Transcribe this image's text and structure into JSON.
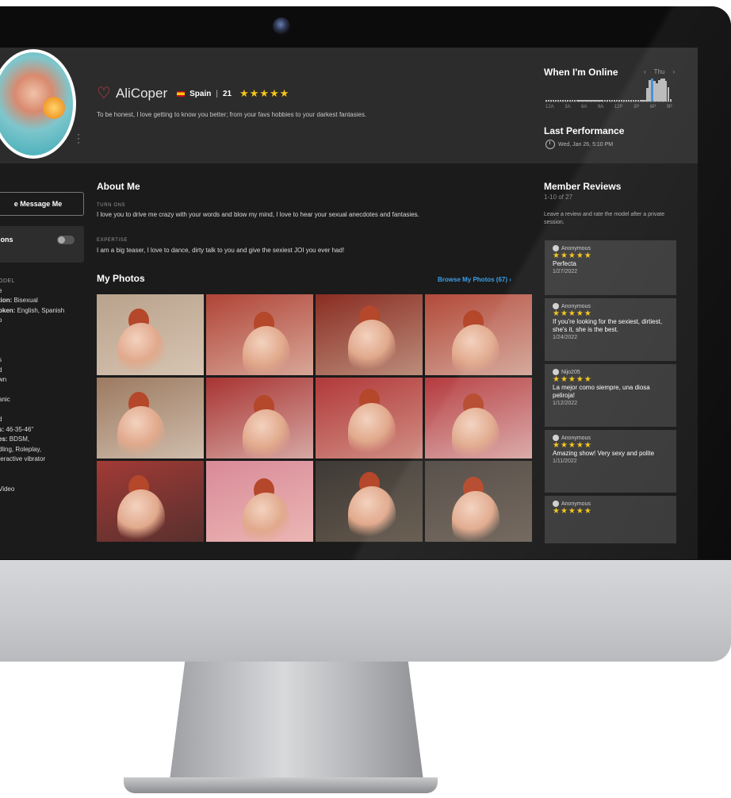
{
  "profile": {
    "name": "AliCoper",
    "country": "Spain",
    "separator": "|",
    "age": "21",
    "stars": "★★★★★",
    "bio": "To be honest, I love getting to know you better; from your favs hobbies to your darkest fantasies.",
    "more_glyph": "⋮",
    "heart_glyph": "♡"
  },
  "online": {
    "title": "When I'm Online",
    "day": "Thu",
    "prev": "‹",
    "next": "›",
    "hours": [
      "12A",
      "3A",
      "6A",
      "9A",
      "12P",
      "3P",
      "6P",
      "9P"
    ],
    "activity": [
      0.05,
      0.05,
      0.05,
      0.05,
      0.05,
      0.05,
      0.05,
      0.05,
      0.05,
      0.05,
      0.05,
      0.05,
      0.05,
      0.05,
      0.05,
      0.05,
      0.05,
      0.05,
      0.05,
      0.05,
      0.05,
      0.05,
      0.05,
      0.05,
      0.05,
      0.05,
      0.05,
      0.05,
      0.05,
      0.05,
      0.05,
      0.05,
      0.05,
      0.05,
      0.05,
      0.05,
      0.05,
      0.05,
      0.05,
      0.05,
      0.05,
      0.05,
      0.05,
      0.55,
      0.9,
      0.95,
      0.85,
      0.75,
      0.9,
      0.95,
      0.95,
      0.85,
      0.6,
      0.1
    ],
    "highlight_index": 45
  },
  "performance": {
    "title": "Last Performance",
    "datetime": "Wed, Jan 26, 5:10 PM"
  },
  "sidebar": {
    "message_button": "e Message Me",
    "notifications_label": "ations",
    "info": [
      {
        "cap": "ODEL",
        "text": ""
      },
      {
        "cap": "",
        "text": "e"
      },
      {
        "cap": "",
        "label": "tion:",
        "text": " Bisexual"
      },
      {
        "cap": "",
        "label": "oken:",
        "text": " English, Spanish"
      },
      {
        "cap": "",
        "text": "o"
      },
      {
        "cap": "",
        "text": ""
      },
      {
        "cap": "",
        "text": ""
      },
      {
        "cap": "",
        "text": ""
      },
      {
        "cap": "",
        "text": "s"
      },
      {
        "cap": "",
        "text": "d"
      },
      {
        "cap": "",
        "text": "wn"
      },
      {
        "cap": "",
        "text": ""
      },
      {
        "cap": "",
        "text": "anic"
      },
      {
        "cap": "",
        "text": ""
      },
      {
        "cap": "",
        "text": "d"
      },
      {
        "cap": "",
        "label": "s:",
        "text": " 46-35-46\""
      },
      {
        "cap": "",
        "label": "es:",
        "text": " BDSM,"
      },
      {
        "cap": "",
        "text": "dling, Roleplay,"
      },
      {
        "cap": "",
        "text": "teractive vibrator"
      },
      {
        "cap": "",
        "text": ""
      },
      {
        "cap": "",
        "text": ""
      },
      {
        "cap": "",
        "text": " Video"
      }
    ]
  },
  "about": {
    "title": "About Me",
    "turn_ons_caption": "TURN ONS",
    "turn_ons": "I love you to drive me crazy with your words and blow my mind, I love to hear your sexual anecdotes and fantasies.",
    "expertise_caption": "EXPERTISE",
    "expertise": "I am a big teaser, I love to dance, dirty talk to you and give the sexiest JOI you ever had!"
  },
  "photos": {
    "title": "My Photos",
    "browse_label": "Browse My Photos (67)",
    "browse_chevron": "›",
    "items": [
      {
        "bg": "#b9a28c",
        "accent": "#e8d8c8"
      },
      {
        "bg": "#b04438",
        "accent": "#f0e2d0"
      },
      {
        "bg": "#8a2d22",
        "accent": "#d9c6b0"
      },
      {
        "bg": "#b34a3a",
        "accent": "#e6ddd2"
      },
      {
        "bg": "#9c7a60",
        "accent": "#efe5da"
      },
      {
        "bg": "#a83432",
        "accent": "#f2ede8"
      },
      {
        "bg": "#b2393a",
        "accent": "#e2c2b0"
      },
      {
        "bg": "#b53a3e",
        "accent": "#f0ebe6"
      },
      {
        "bg": "#a23a35",
        "accent": "#2a2a2a"
      },
      {
        "bg": "#d98a98",
        "accent": "#f6d0c4"
      },
      {
        "bg": "#3e3a36",
        "accent": "#7a6a58"
      },
      {
        "bg": "#504842",
        "accent": "#86786a"
      }
    ]
  },
  "reviews": {
    "title": "Member Reviews",
    "count": "1-10 of 27",
    "note": "Leave a review and rate the model after a private session.",
    "items": [
      {
        "user": "Anonymous",
        "stars": "★★★★★",
        "text": "Perfecta",
        "date": "1/27/2022"
      },
      {
        "user": "Anonymous",
        "stars": "★★★★★",
        "text": "If you're looking for the sexiest, dirtiest, she's it, she is the best.",
        "date": "1/24/2022"
      },
      {
        "user": "Nijo205",
        "stars": "★★★★★",
        "text": "La mejor como siempre, una diosa peliroja!",
        "date": "1/12/2022"
      },
      {
        "user": "Anonymous",
        "stars": "★★★★★",
        "text": "Amazing show! Very sexy and polite",
        "date": "1/11/2022"
      },
      {
        "user": "Anonymous",
        "stars": "★★★★★",
        "text": "",
        "date": ""
      }
    ]
  }
}
